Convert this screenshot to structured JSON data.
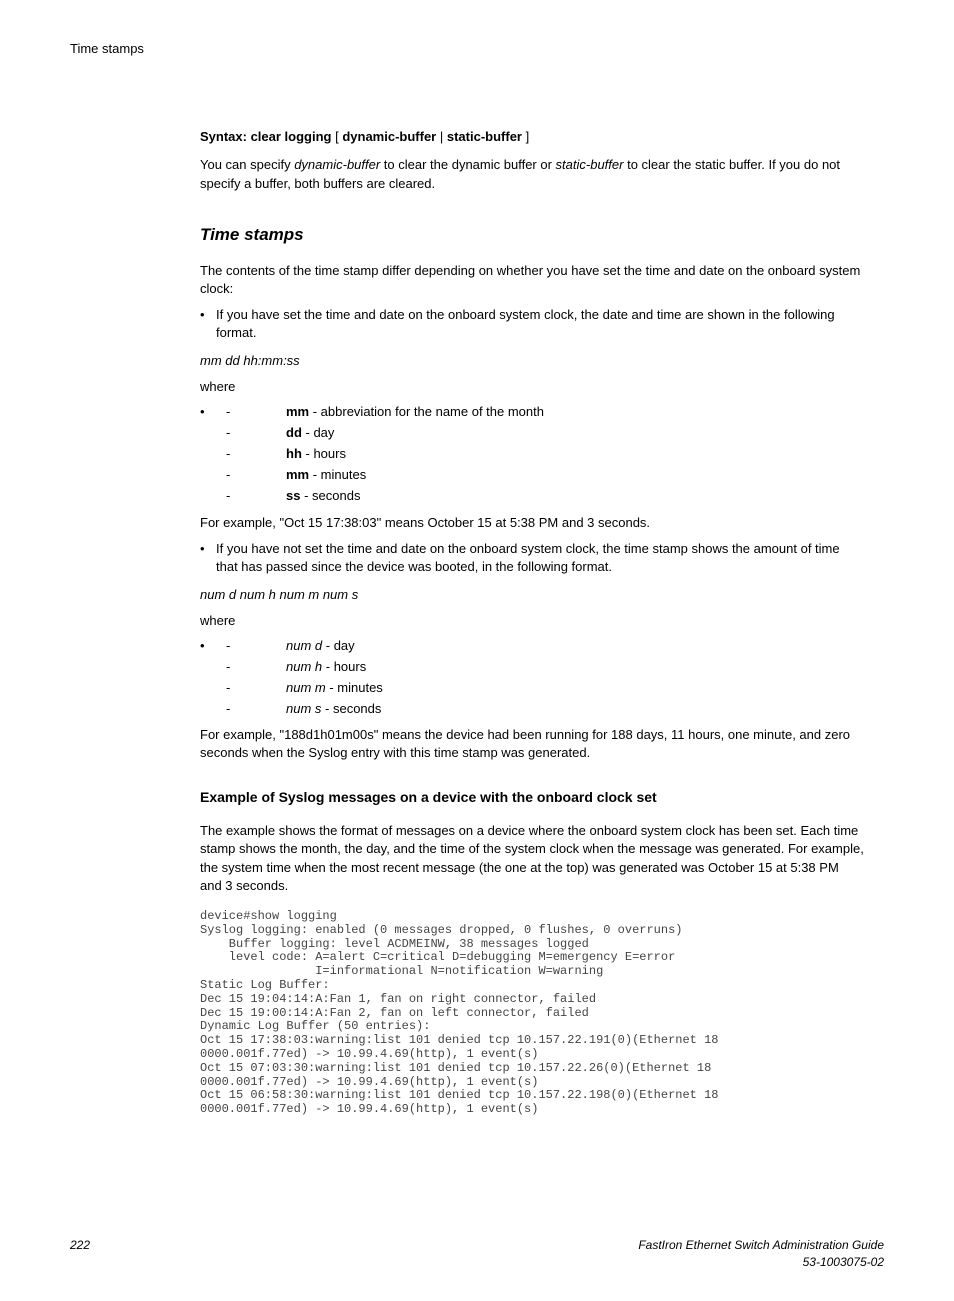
{
  "header": "Time stamps",
  "syntax": {
    "prefix": "Syntax: clear logging",
    "opt1": "dynamic-buffer",
    "opt2": "static-buffer"
  },
  "intro_p1a": "You can specify ",
  "intro_p1b": "dynamic-buffer",
  "intro_p1c": " to clear the dynamic buffer or ",
  "intro_p1d": "static-buffer",
  "intro_p1e": " to clear the static buffer. If you do not specify a buffer, both buffers are cleared.",
  "heading1": "Time stamps",
  "p2": "The contents of the time stamp differ depending on whether you have set the time and date on the onboard system clock:",
  "bullet1": "If you have set the time and date on the onboard system clock, the date and time are shown in the following format.",
  "format1": "mm dd hh:mm:ss",
  "where": "where",
  "defs1": [
    {
      "term": "mm",
      "desc": " - abbreviation for the name of the month",
      "bold": true
    },
    {
      "term": "dd",
      "desc": " - day",
      "bold": true
    },
    {
      "term": "hh",
      "desc": " - hours",
      "bold": true
    },
    {
      "term": "mm",
      "desc": " - minutes",
      "bold": true
    },
    {
      "term": "ss",
      "desc": " - seconds",
      "bold": true
    }
  ],
  "example1": "For example, \"Oct 15 17:38:03\" means October 15 at 5:38 PM and 3 seconds.",
  "bullet2": "If you have not set the time and date on the onboard system clock, the time stamp shows the amount of time that has passed since the device was booted, in the following format.",
  "format2": "num d num h num m num s",
  "defs2": [
    {
      "term": "num d",
      "desc": " - day"
    },
    {
      "term": "num h",
      "desc": " - hours"
    },
    {
      "term": "num m",
      "desc": " - minutes"
    },
    {
      "term": "num s",
      "desc": " - seconds"
    }
  ],
  "example2": "For example, \"188d1h01m00s\" means the device had been running for 188 days, 11 hours, one minute, and zero seconds when the Syslog entry with this time stamp was generated.",
  "heading2": "Example of Syslog messages on a device with the onboard clock set",
  "p3": "The example shows the format of messages on a device where the onboard system clock has been set. Each time stamp shows the month, the day, and the time of the system clock when the message was generated. For example, the system time when the most recent message (the one at the top) was generated was October 15 at 5:38 PM and 3 seconds.",
  "code": "device#show logging\nSyslog logging: enabled (0 messages dropped, 0 flushes, 0 overruns)\n    Buffer logging: level ACDMEINW, 38 messages logged\n    level code: A=alert C=critical D=debugging M=emergency E=error\n                I=informational N=notification W=warning\nStatic Log Buffer:\nDec 15 19:04:14:A:Fan 1, fan on right connector, failed\nDec 15 19:00:14:A:Fan 2, fan on left connector, failed\nDynamic Log Buffer (50 entries):\nOct 15 17:38:03:warning:list 101 denied tcp 10.157.22.191(0)(Ethernet 18 \n0000.001f.77ed) -> 10.99.4.69(http), 1 event(s)\nOct 15 07:03:30:warning:list 101 denied tcp 10.157.22.26(0)(Ethernet 18 \n0000.001f.77ed) -> 10.99.4.69(http), 1 event(s)\nOct 15 06:58:30:warning:list 101 denied tcp 10.157.22.198(0)(Ethernet 18 \n0000.001f.77ed) -> 10.99.4.69(http), 1 event(s)",
  "footer": {
    "page": "222",
    "title": "FastIron Ethernet Switch Administration Guide",
    "docnum": "53-1003075-02"
  }
}
